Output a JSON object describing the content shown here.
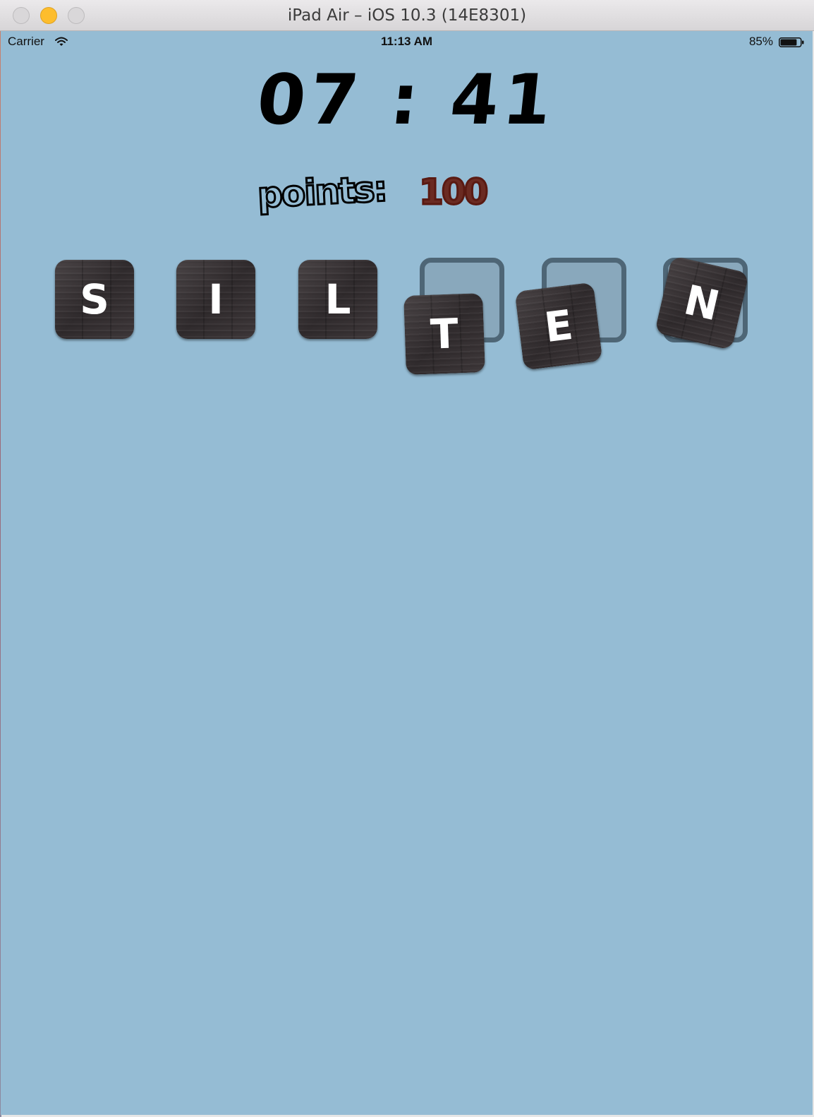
{
  "window": {
    "title": "iPad Air – iOS 10.3 (14E8301)"
  },
  "status_bar": {
    "carrier": "Carrier",
    "time": "11:13 AM",
    "battery_percent": "85%",
    "battery_level": 0.85
  },
  "game": {
    "timer": {
      "minutes": "07",
      "separator": ":",
      "seconds": "41"
    },
    "points": {
      "label": "points:",
      "value": "100"
    },
    "placed_tiles": [
      "S",
      "I",
      "L"
    ],
    "loose_tiles": [
      "T",
      "E",
      "N"
    ],
    "empty_slots": 3
  },
  "colors": {
    "background": "#95bcd4",
    "slot_border": "#4e6676",
    "points_value": "#6b2b22",
    "tile_text": "#ffffff"
  }
}
